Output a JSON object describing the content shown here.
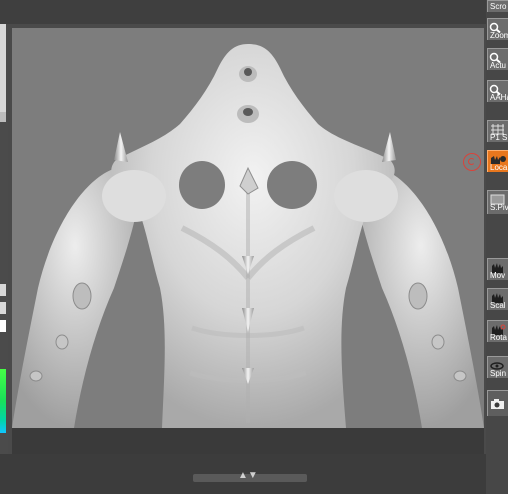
{
  "tools": [
    {
      "id": "scroll",
      "label": "Scro",
      "icon": "hand-scroll-icon"
    },
    {
      "id": "zoom",
      "label": "Zoom",
      "icon": "magnifier-icon"
    },
    {
      "id": "actual",
      "label": "Actu",
      "icon": "magnifier-actual-icon"
    },
    {
      "id": "aahalf",
      "label": "AAHa",
      "icon": "magnifier-aa-icon"
    },
    {
      "id": "persp",
      "label": "P1 S",
      "icon": "grid-perspective-icon"
    },
    {
      "id": "local",
      "label": "Loca",
      "icon": "local-transform-icon",
      "active": true
    },
    {
      "id": "spivot",
      "label": "S.Piv",
      "icon": "pivot-box-icon"
    },
    {
      "id": "move",
      "label": "Mov",
      "icon": "move-hand-icon"
    },
    {
      "id": "scale",
      "label": "Scal",
      "icon": "scale-hand-icon"
    },
    {
      "id": "rotate",
      "label": "Rota",
      "icon": "rotate-hand-icon"
    },
    {
      "id": "spin",
      "label": "Spin",
      "icon": "spin-icon"
    },
    {
      "id": "camera",
      "label": "",
      "icon": "camera-icon"
    }
  ],
  "colors": {
    "accent": "#e8771e",
    "marker": "#d9433b",
    "canvas": "#7d7d7d"
  }
}
